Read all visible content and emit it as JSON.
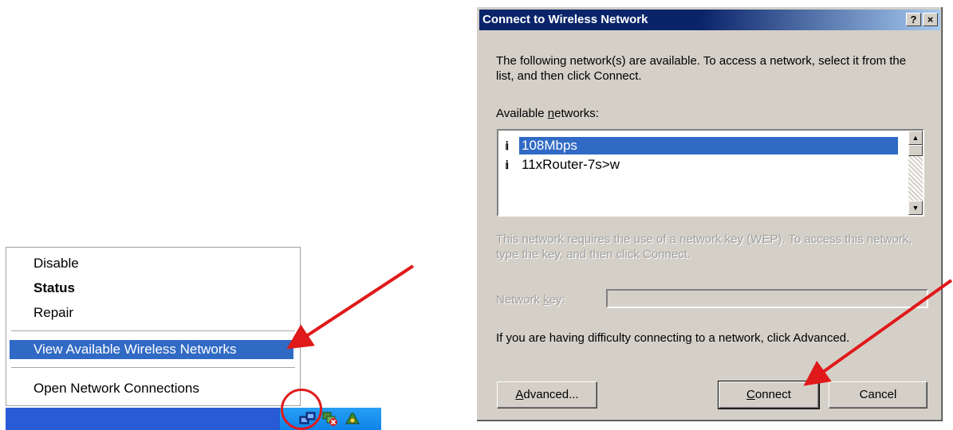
{
  "context_menu": {
    "items": [
      {
        "label": "Disable"
      },
      {
        "label": "Status"
      },
      {
        "label": "Repair"
      },
      {
        "label": "View Available Wireless Networks"
      },
      {
        "label": "Open Network Connections"
      }
    ]
  },
  "tray": {
    "icons": [
      "network-connection-icon",
      "network-disconnected-icon",
      "wireless-utility-icon"
    ]
  },
  "dialog": {
    "title": "Connect to Wireless Network",
    "help_button": "?",
    "close_button": "×",
    "intro": "The following network(s) are available. To access a network, select it from the list, and then click Connect.",
    "available_label_pre": "Available ",
    "available_label_underlined": "n",
    "available_label_post": "etworks:",
    "networks": [
      {
        "name": "108Mbps",
        "selected": true
      },
      {
        "name": "11xRouter-7s>w",
        "selected": false
      }
    ],
    "wep_note": "This network requires the use of a network key (WEP). To access this network, type the key, and then click Connect.",
    "network_key_label_pre": "Network ",
    "network_key_label_underlined": "k",
    "network_key_label_post": "ey:",
    "network_key_value": "",
    "advanced_note": "If you are having difficulty connecting to a network, click Advanced.",
    "buttons": {
      "advanced_underlined": "A",
      "advanced_rest": "dvanced...",
      "connect_underlined": "C",
      "connect_rest": "onnect",
      "cancel": "Cancel"
    }
  },
  "colors": {
    "selection": "#316ac5",
    "annotation": "#e0191a",
    "dialog_face": "#d4d0c8",
    "title_dark": "#0a246a",
    "taskbar": "#2a5bd6"
  }
}
